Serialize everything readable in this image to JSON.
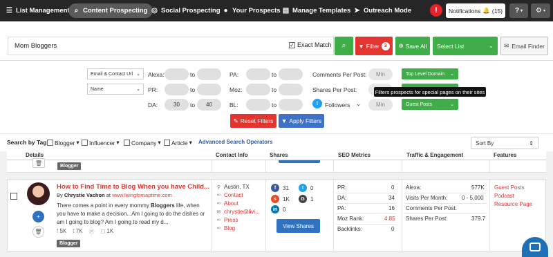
{
  "nav": {
    "items": [
      {
        "label": "List Management",
        "icon": "list-icon"
      },
      {
        "label": "Content Prospecting",
        "icon": "search-icon"
      },
      {
        "label": "Social Prospecting",
        "icon": "social-icon"
      },
      {
        "label": "Your Prospects",
        "icon": "users-icon"
      },
      {
        "label": "Manage Templates",
        "icon": "templates-icon"
      },
      {
        "label": "Outreach Mode",
        "icon": "send-icon"
      }
    ],
    "alert": "!",
    "notifications_label": "Notifications",
    "notifications_count": "(15)",
    "help": "?"
  },
  "search": {
    "query": "Mom Bloggers",
    "exact_match_label": "Exact Match",
    "exact_match_checked": true,
    "filter_label": "Filter",
    "filter_count": "3",
    "save_all_label": "Save All",
    "select_list_label": "Select List",
    "email_finder_label": "Email Finder"
  },
  "filters": {
    "email_select": "Email & Contact Url",
    "name_select": "Name",
    "alexa_label": "Alexa:",
    "pr_label": "PR:",
    "da_label": "DA:",
    "da_from": "30",
    "da_to": "40",
    "to": "to",
    "pa_label": "PA:",
    "moz_label": "Moz:",
    "bl_label": "BL:",
    "comments_label": "Comments Per Post:",
    "shares_label": "Shares Per Post:",
    "followers_label": "Followers",
    "min": "Min",
    "top_level_domain": "Top Level Domain",
    "guest_posts": "Guest Posts",
    "tooltip": "Filters prospects for special pages on their sites",
    "reset_label": "Reset Filters",
    "apply_label": "Apply Filters"
  },
  "tagbar": {
    "search_by_tag": "Search by Tag:",
    "tags": [
      "Blogger",
      "Influencer",
      "Company",
      "Article"
    ],
    "advanced": "Advanced Search Operators",
    "sort_by": "Sort By"
  },
  "table": {
    "headers": [
      "Details",
      "Contact Info",
      "Shares",
      "SEO Metrics",
      "Traffic & Engagement",
      "Features"
    ],
    "prev_tag": "Blogger"
  },
  "result": {
    "title": "How to Find Time to Blog When you have Child...",
    "by": "By",
    "author": "Chrystie Vachon",
    "at": "at",
    "url": "www.livingfornaptime.com",
    "snippet_pre": "There comes a point in every mommy ",
    "snippet_bold": "Bloggers",
    "snippet_post": " life, when you have to make a decision...Am I going to do the dishes or am I going to blog? Am I going to read my d...",
    "social_fb": "5K",
    "social_tw": "7K",
    "social_other": "1K",
    "tag": "Blogger",
    "contact": {
      "location": "Austin, TX",
      "contact": "Contact",
      "about": "About",
      "email": "chrystie@livi...",
      "press": "Press",
      "blog": "Blog"
    },
    "shares": {
      "facebook": "31",
      "twitter": "0",
      "stumbleupon": "1K",
      "googleplus": "1",
      "linkedin": "0",
      "view_label": "View Shares"
    },
    "seo": [
      {
        "label": "PR:",
        "value": "0"
      },
      {
        "label": "DA:",
        "value": "34"
      },
      {
        "label": "PA:",
        "value": "16"
      },
      {
        "label": "Moz Rank:",
        "value": "4.85"
      },
      {
        "label": "Backlinks:",
        "value": "0"
      }
    ],
    "traffic": [
      {
        "label": "Alexa:",
        "value": "577K"
      },
      {
        "label": "Visits Per Month:",
        "value": "0 - 5,000"
      },
      {
        "label": "Comments Per Post:",
        "value": ""
      },
      {
        "label": "Shares Per Post:",
        "value": "379.7"
      }
    ],
    "features": [
      "Guest Posts",
      "Podcast",
      "Resource Page"
    ]
  },
  "colors": {
    "green": "#3fae49",
    "red": "#e3342f",
    "blue": "#2f72bf",
    "nav_bg": "#262626"
  }
}
